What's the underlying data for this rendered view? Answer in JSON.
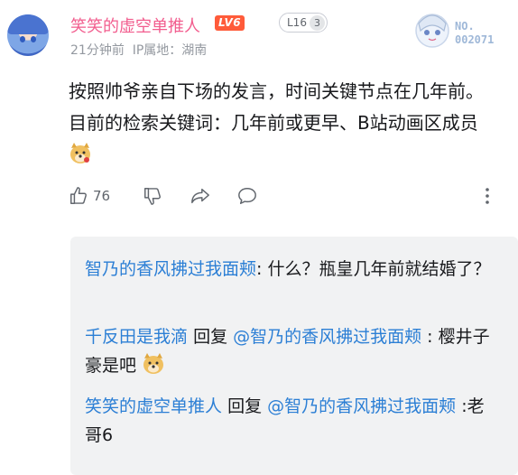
{
  "comment": {
    "username": "笑笑的虚空单推人",
    "level_badge": "LV6",
    "fan_badge": {
      "label": "L16",
      "count": "3"
    },
    "time": "21分钟前",
    "ip_location": "IP属地：湖南",
    "garb_number": [
      "NO.",
      "002071"
    ],
    "text": "按照帅爷亲自下场的发言，时间关键节点在几年前。目前的检索关键词：几年前或更早、B站动画区成员",
    "like_count": "76"
  },
  "replies": [
    {
      "author": "智乃的香风拂过我面颊",
      "reply_to": "",
      "text": "什么？瓶皇几年前就结婚了？"
    },
    {
      "author": "千反田是我滴",
      "reply_word": "回复",
      "reply_to": "@智乃的香风拂过我面颊",
      "text": "樱井子豪是吧"
    },
    {
      "author": "笑笑的虚空单推人",
      "reply_word": "回复",
      "reply_to": "@智乃的香风拂过我面颊",
      "text": ":老哥6"
    }
  ],
  "icons": [
    "thumb-up-icon",
    "thumb-down-icon",
    "share-icon",
    "comment-icon",
    "more-icon",
    "doge-emoji"
  ],
  "colors": {
    "username": "#f25d8e",
    "link": "#2c7fd5",
    "level": "#ff5b3a"
  }
}
